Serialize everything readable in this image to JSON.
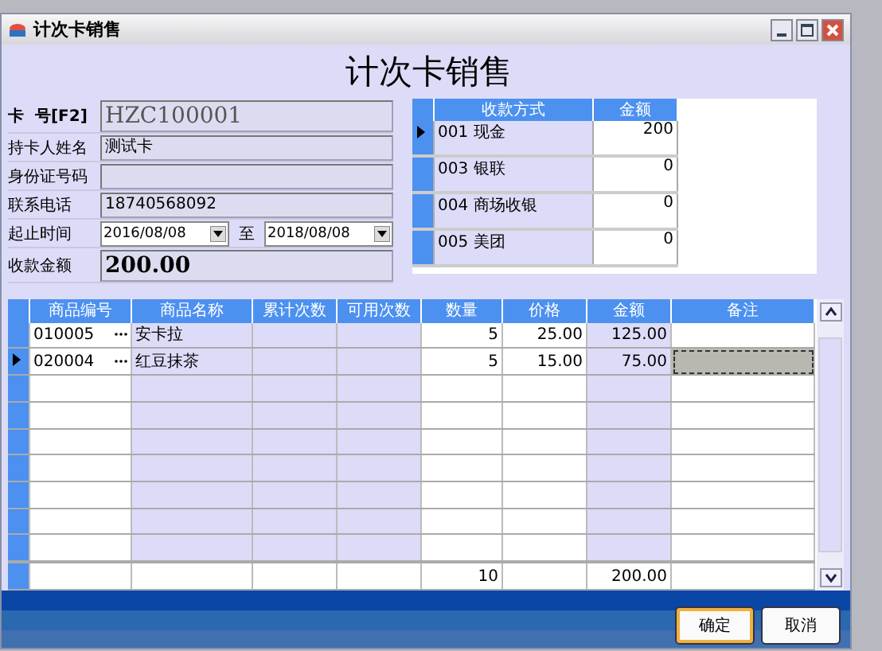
{
  "window": {
    "title": "计次卡销售"
  },
  "heading": "计次卡销售",
  "form": {
    "card_no": {
      "label": "卡  号[F2]",
      "value": "HZC100001"
    },
    "fields": [
      {
        "label": "持卡人姓名",
        "value": "测试卡"
      },
      {
        "label": "身份证号码"
      },
      {
        "label": "联系电话",
        "value": "18740568092"
      }
    ],
    "period": {
      "label": "起止时间",
      "from": "2016/08/08",
      "separator": "至",
      "to": "2018/08/08"
    },
    "amount": {
      "label": "收款金额",
      "value": "200.00"
    }
  },
  "payment_table": {
    "columns": [
      "收款方式",
      "金额"
    ],
    "rows": [
      {
        "method": "001  现金",
        "amount": "200",
        "selected": true
      },
      {
        "method": "003  银联",
        "amount": "0",
        "selected": false
      },
      {
        "method": "004  商场收银",
        "amount": "0",
        "selected": false
      },
      {
        "method": "005  美团",
        "amount": "0",
        "selected": false
      }
    ]
  },
  "items_table": {
    "columns": [
      "商品编号",
      "商品名称",
      "累计次数",
      "可用次数",
      "数量",
      "价格",
      "金额",
      "备注"
    ],
    "rows": [
      {
        "code": "010005",
        "name": "安卡拉",
        "qty": "5",
        "price": "25.00",
        "amount": "125.00",
        "selected": false
      },
      {
        "code": "020004",
        "name": "红豆抹茶",
        "qty": "5",
        "price": "15.00",
        "amount": "75.00",
        "selected": true
      }
    ],
    "totals": {
      "qty": "10",
      "amount": "200.00"
    }
  },
  "buttons": [
    "确定",
    "取消"
  ]
}
